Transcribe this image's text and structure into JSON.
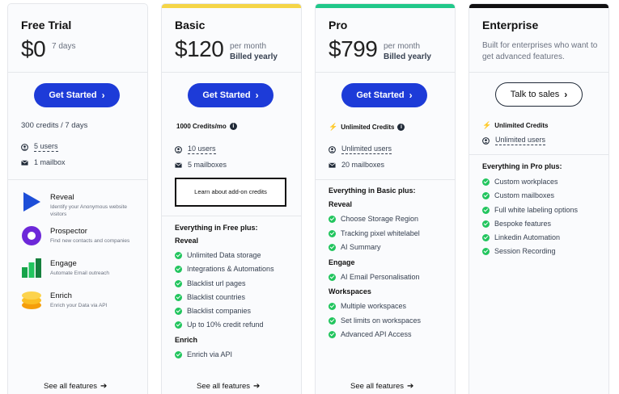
{
  "colors": {
    "basic_accent": "#f5d547",
    "pro_accent": "#21c88a",
    "enterprise_accent": "#111111",
    "primary_button": "#1d3bd8",
    "check": "#22c55e"
  },
  "free": {
    "name": "Free Trial",
    "price": "$0",
    "price_note": "7 days",
    "cta": "Get Started",
    "credits": "300 credits / 7 days",
    "users": "5 users",
    "mailbox": "1 mailbox",
    "products": [
      {
        "name": "Reveal",
        "desc": "Identify your Anonymous website visitors",
        "icon": "play-triangle-icon"
      },
      {
        "name": "Prospector",
        "desc": "Find new contacts and companies",
        "icon": "purple-circle-icon"
      },
      {
        "name": "Engage",
        "desc": "Automate Email outreach",
        "icon": "green-bars-icon"
      },
      {
        "name": "Enrich",
        "desc": "Enrich your Data via API",
        "icon": "yellow-stack-icon"
      }
    ],
    "see_all": "See all features"
  },
  "basic": {
    "name": "Basic",
    "price": "$120",
    "price_note_1": "per month",
    "price_note_2": "Billed yearly",
    "cta": "Get Started",
    "credits": "1000 Credits/mo",
    "users": "10 users",
    "mailboxes": "5 mailboxes",
    "addon": "Learn about add-on credits",
    "features_title": "Everything in Free plus:",
    "group_1": "Reveal",
    "group_1_items": [
      "Unlimited Data storage",
      "Integrations & Automations",
      "Blacklist url pages",
      "Blacklist countries",
      "Blacklist companies",
      "Up to 10% credit refund"
    ],
    "group_2": "Enrich",
    "group_2_items": [
      "Enrich via API"
    ],
    "see_all": "See all features"
  },
  "pro": {
    "name": "Pro",
    "price": "$799",
    "price_note_1": "per month",
    "price_note_2": "Billed yearly",
    "cta": "Get Started",
    "credits": "Unlimited Credits",
    "users": "Unlimited users",
    "mailboxes": "20 mailboxes",
    "features_title": "Everything in Basic plus:",
    "group_1": "Reveal",
    "group_1_items": [
      "Choose Storage Region",
      "Tracking pixel whitelabel",
      "AI Summary"
    ],
    "group_2": "Engage",
    "group_2_items": [
      "AI Email Personalisation"
    ],
    "group_3": "Workspaces",
    "group_3_items": [
      "Multiple workspaces",
      "Set limits on workspaces",
      "Advanced API Access"
    ],
    "see_all": "See all features"
  },
  "enterprise": {
    "name": "Enterprise",
    "desc": "Built for enterprises who want to get advanced features.",
    "cta": "Talk to sales",
    "credits": "Unlimited Credits",
    "users": "Unlimited users",
    "features_title": "Everything in Pro plus:",
    "items": [
      "Custom workplaces",
      "Custom mailboxes",
      "Full white labeling options",
      "Bespoke features",
      "Linkedin Automation",
      "Session Recording"
    ]
  }
}
